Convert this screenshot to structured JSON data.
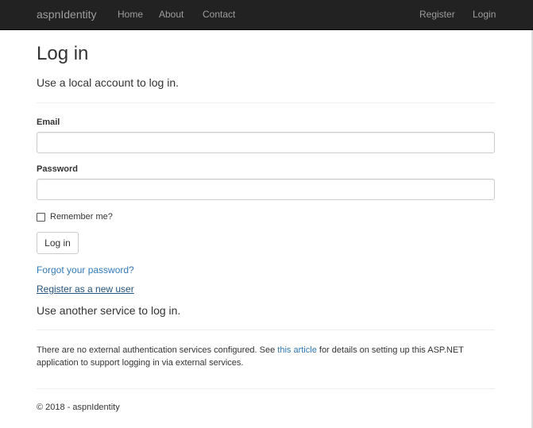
{
  "navbar": {
    "brand": "aspnIdentity",
    "links": [
      "Home",
      "About",
      "Contact"
    ],
    "register": "Register",
    "login": "Login",
    "background": "#222222",
    "text_color": "#9d9d9d"
  },
  "page": {
    "title": "Log in",
    "subtitle": "Use a local account to log in."
  },
  "form": {
    "email_label": "Email",
    "email_value": "",
    "password_label": "Password",
    "password_value": "",
    "remember_label": "Remember me?",
    "remember_checked": false,
    "submit_label": "Log in"
  },
  "links": {
    "forgot_password": "Forgot your password?",
    "register_new_user": "Register as a new user",
    "color": "#337ab7"
  },
  "external": {
    "title": "Use another service to log in.",
    "text_before": "There are no external authentication services configured. See ",
    "link_text": "this article",
    "text_after": " for details on setting up this ASP.NET application to support logging in via external services."
  },
  "footer": {
    "text": "© 2018 - aspnIdentity"
  }
}
